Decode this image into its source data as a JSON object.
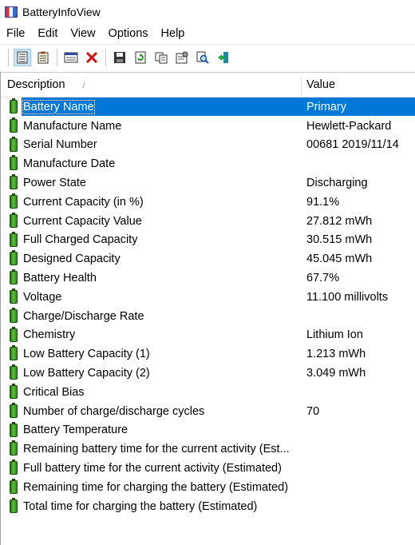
{
  "window": {
    "title": "BatteryInfoView"
  },
  "menu": [
    "File",
    "Edit",
    "View",
    "Options",
    "Help"
  ],
  "toolbar": {
    "icons": [
      "details-view-icon",
      "list-view-icon",
      "columns-icon",
      "delete-icon",
      "save-icon",
      "refresh-icon",
      "copy-icon",
      "properties-icon",
      "find-icon",
      "exit-icon"
    ]
  },
  "columns": {
    "description": "Description",
    "value": "Value"
  },
  "rows": [
    {
      "d": "Battery Name",
      "v": "Primary"
    },
    {
      "d": "Manufacture Name",
      "v": "Hewlett-Packard"
    },
    {
      "d": "Serial Number",
      "v": "00681 2019/11/14"
    },
    {
      "d": "Manufacture Date",
      "v": ""
    },
    {
      "d": "Power State",
      "v": "Discharging"
    },
    {
      "d": "Current Capacity (in %)",
      "v": "91.1%"
    },
    {
      "d": "Current Capacity Value",
      "v": "27.812 mWh"
    },
    {
      "d": "Full Charged Capacity",
      "v": "30.515 mWh"
    },
    {
      "d": "Designed Capacity",
      "v": "45.045 mWh"
    },
    {
      "d": "Battery Health",
      "v": "67.7%"
    },
    {
      "d": "Voltage",
      "v": "11.100 millivolts"
    },
    {
      "d": "Charge/Discharge Rate",
      "v": ""
    },
    {
      "d": "Chemistry",
      "v": "Lithium Ion"
    },
    {
      "d": "Low Battery Capacity (1)",
      "v": "1.213 mWh"
    },
    {
      "d": "Low Battery Capacity (2)",
      "v": "3.049 mWh"
    },
    {
      "d": "Critical Bias",
      "v": ""
    },
    {
      "d": "Number of charge/discharge cycles",
      "v": "70"
    },
    {
      "d": "Battery Temperature",
      "v": ""
    },
    {
      "d": "Remaining battery time for the current activity (Est...",
      "v": ""
    },
    {
      "d": "Full battery time for the current activity (Estimated)",
      "v": ""
    },
    {
      "d": "Remaining time for charging the battery (Estimated)",
      "v": ""
    },
    {
      "d": "Total  time for charging the battery (Estimated)",
      "v": ""
    }
  ],
  "selected_row": 0
}
